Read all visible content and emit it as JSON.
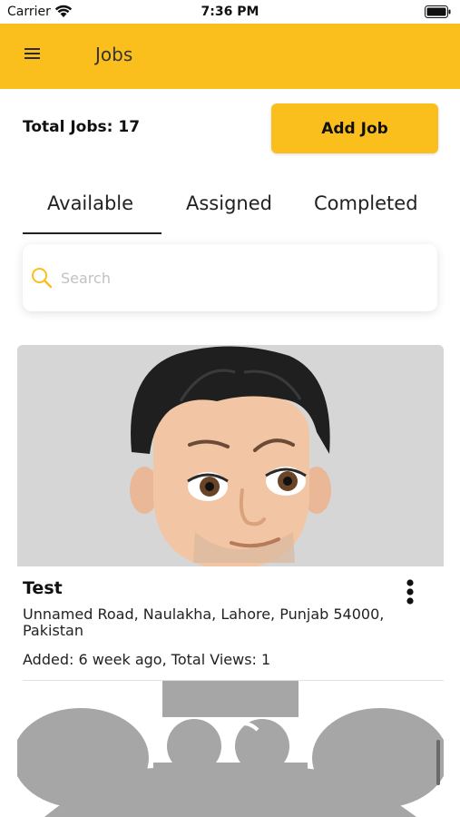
{
  "status_bar": {
    "carrier": "Carrier",
    "time": "7:36 PM"
  },
  "header": {
    "title": "Jobs",
    "menu_icon": "hamburger-menu-icon",
    "background_color": "#FBBF1D"
  },
  "summary": {
    "total_jobs_label": "Total Jobs:  17",
    "add_job_label": "Add Job"
  },
  "tabs": [
    {
      "label": "Available",
      "selected": true
    },
    {
      "label": "Assigned",
      "selected": false
    },
    {
      "label": "Completed",
      "selected": false
    }
  ],
  "search": {
    "placeholder": "Search",
    "value": "",
    "icon": "search-icon",
    "icon_color": "#FBBF1D"
  },
  "jobs": [
    {
      "title": "Test",
      "address": "Unnamed Road, Naulakha, Lahore, Punjab 54000, Pakistan",
      "meta": "Added: 6 week ago, Total Views: 1",
      "image": "cartoon-avatar-photo",
      "menu_icon": "more-vertical-icon"
    }
  ],
  "next_card_image": "placeholder-image"
}
